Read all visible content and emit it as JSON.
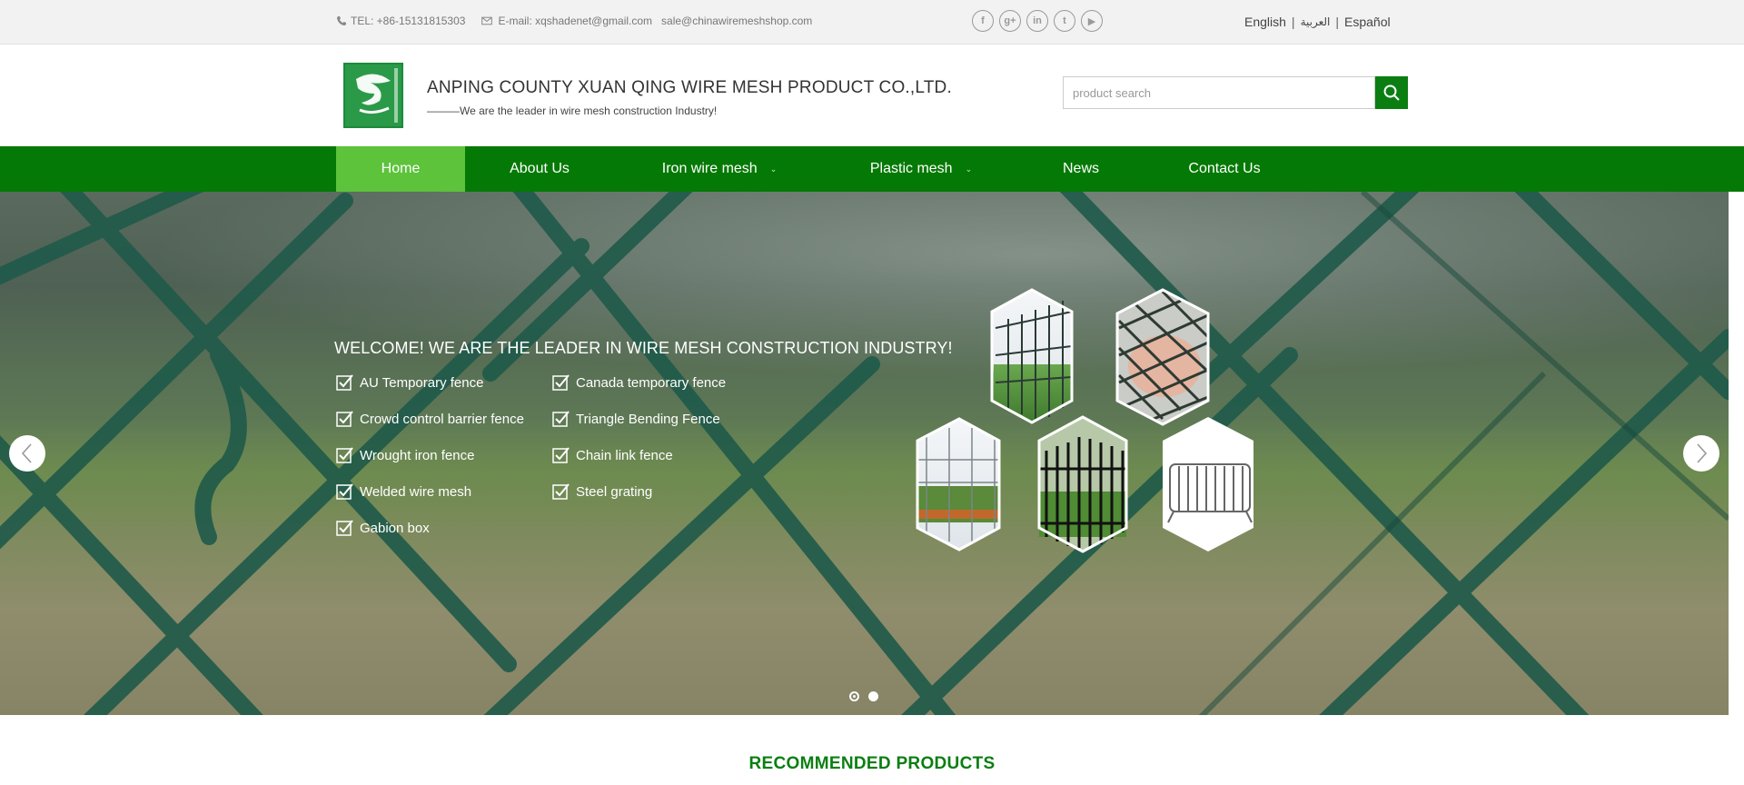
{
  "topbar": {
    "tel": "TEL: +86-15131815303",
    "email_label": "E-mail: xqshadenet@gmail.com",
    "email2": "sale@chinawiremeshshop.com",
    "social": [
      {
        "icon": "facebook-icon",
        "glyph": "f"
      },
      {
        "icon": "google-plus-icon",
        "glyph": "g+"
      },
      {
        "icon": "linkedin-icon",
        "glyph": "in"
      },
      {
        "icon": "twitter-icon",
        "glyph": "t"
      },
      {
        "icon": "youtube-icon",
        "glyph": "▶"
      }
    ],
    "languages": [
      "English",
      "العربية",
      "Español"
    ],
    "separator": "|"
  },
  "header": {
    "company": "ANPING COUNTY XUAN QING WIRE MESH PRODUCT CO.,LTD.",
    "slogan": "———We are the leader in wire mesh construction Industry!",
    "search_placeholder": "product search",
    "brand_color": "#0b7e12"
  },
  "nav": {
    "items": [
      {
        "label": "Home",
        "active": true
      },
      {
        "label": "About Us"
      },
      {
        "label": "Iron wire mesh",
        "dropdown": true
      },
      {
        "label": "Plastic mesh",
        "dropdown": true
      },
      {
        "label": "News"
      },
      {
        "label": "Contact Us"
      }
    ],
    "caret": "⌄"
  },
  "hero": {
    "title": "WELCOME! WE ARE THE LEADER IN WIRE MESH CONSTRUCTION INDUSTRY!",
    "features_left": [
      "AU Temporary fence",
      "Crowd control barrier fence",
      "Wrought iron fence",
      "Welded wire mesh",
      "Gabion box"
    ],
    "features_right": [
      "Canada temporary fence",
      "Triangle Bending Fence",
      "Chain link fence",
      "Steel grating"
    ],
    "slides": 2,
    "active_slide": 0
  },
  "section": {
    "title": "RECOMMENDED PRODUCTS"
  }
}
